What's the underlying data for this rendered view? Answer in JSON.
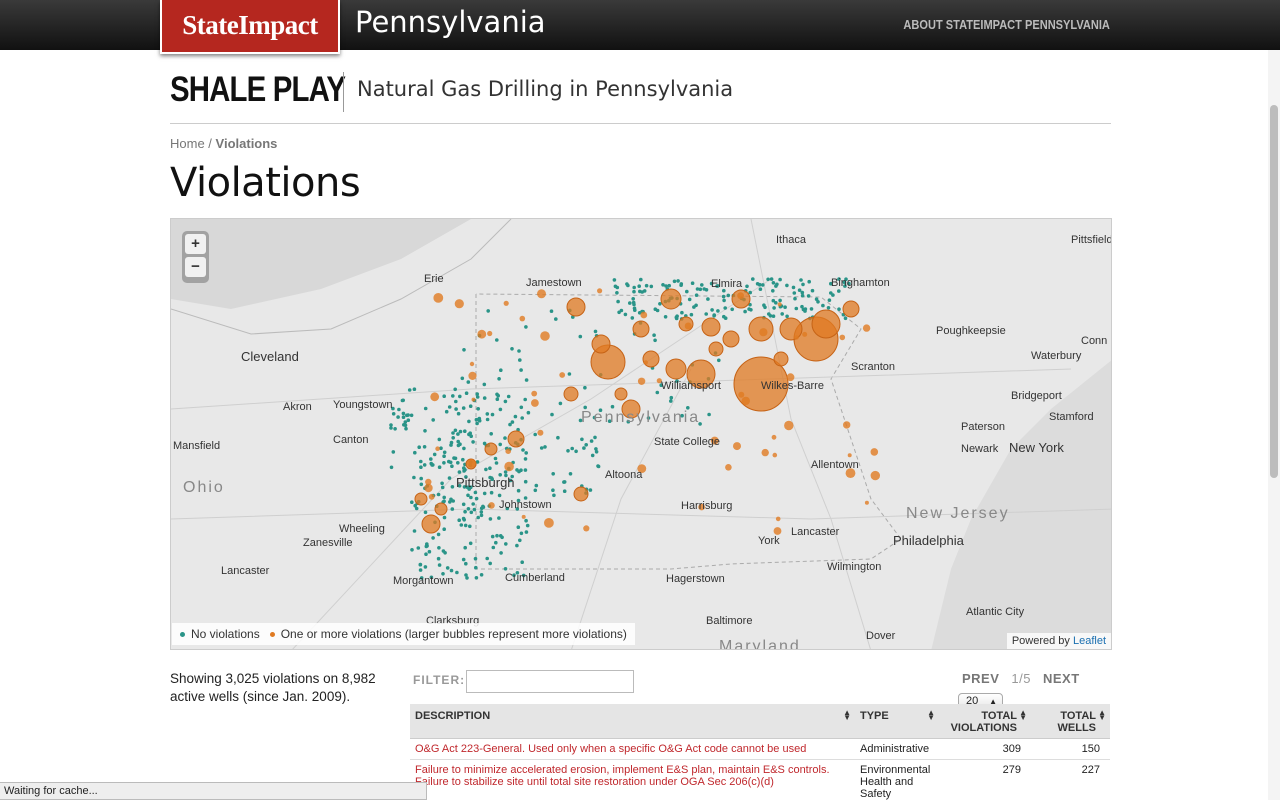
{
  "topbar": {
    "brand": "StateImpact",
    "state": "Pennsylvania",
    "about_link": "ABOUT STATEIMPACT PENNSYLVANIA"
  },
  "header": {
    "section": "SHALE PLAY",
    "subtitle": "Natural Gas Drilling in Pennsylvania"
  },
  "breadcrumb": {
    "home": "Home",
    "sep": " / ",
    "current": "Violations"
  },
  "page_title": "Violations",
  "map": {
    "zoom_in": "+",
    "zoom_out": "−",
    "labels": [
      "Ithaca",
      "Pittsfield",
      "Erie",
      "Jamestown",
      "Elmira",
      "Binghamton",
      "Poughkeepsie",
      "Conn",
      "Waterbury",
      "Cleveland",
      "Scranton",
      "Akron",
      "Youngstown",
      "Williamsport",
      "Wilkes-Barre",
      "Bridgeport",
      "Stamford",
      "Pennsylvania",
      "Mansfield",
      "Canton",
      "State College",
      "Paterson",
      "Newark",
      "New York",
      "Allentown",
      "Ohio",
      "Pittsburgh",
      "Altoona",
      "Johnstown",
      "Harrisburg",
      "New Jersey",
      "Wheeling",
      "Zanesville",
      "Lancaster",
      "York",
      "Philadelphia",
      "Lancaster",
      "Cumberland",
      "Hagerstown",
      "Wilmington",
      "Morgantown",
      "Atlantic City",
      "Baltimore",
      "Dover",
      "Maryland",
      "Clarksburg"
    ],
    "legend_no": "No violations",
    "legend_yes": "One or more violations (larger bubbles represent more violations)",
    "attribution_prefix": "Powered by ",
    "attribution_link": "Leaflet",
    "colors": {
      "no_violation": "#2a9488",
      "violation": "#e07a22"
    }
  },
  "summary": "Showing 3,025 violations on 8,982 active wells (since Jan. 2009).",
  "filter": {
    "label": "FILTER:",
    "value": ""
  },
  "pager": {
    "prev": "PREV",
    "page": "1/5",
    "next": "NEXT",
    "per_page": "20"
  },
  "table": {
    "headers": [
      "DESCRIPTION",
      "TYPE",
      "TOTAL VIOLATIONS",
      "TOTAL WELLS"
    ],
    "rows": [
      {
        "description": "O&G Act 223-General. Used only when a specific O&G Act code cannot be used",
        "type": "Administrative",
        "violations": "309",
        "wells": "150"
      },
      {
        "description": "Failure to minimize accelerated erosion, implement E&S plan, maintain E&S controls. Failure to stabilize site until total site restoration under OGA Sec 206(c)(d)",
        "type": "Environmental Health and Safety",
        "violations": "279",
        "wells": "227"
      }
    ]
  },
  "status": "Waiting for cache..."
}
